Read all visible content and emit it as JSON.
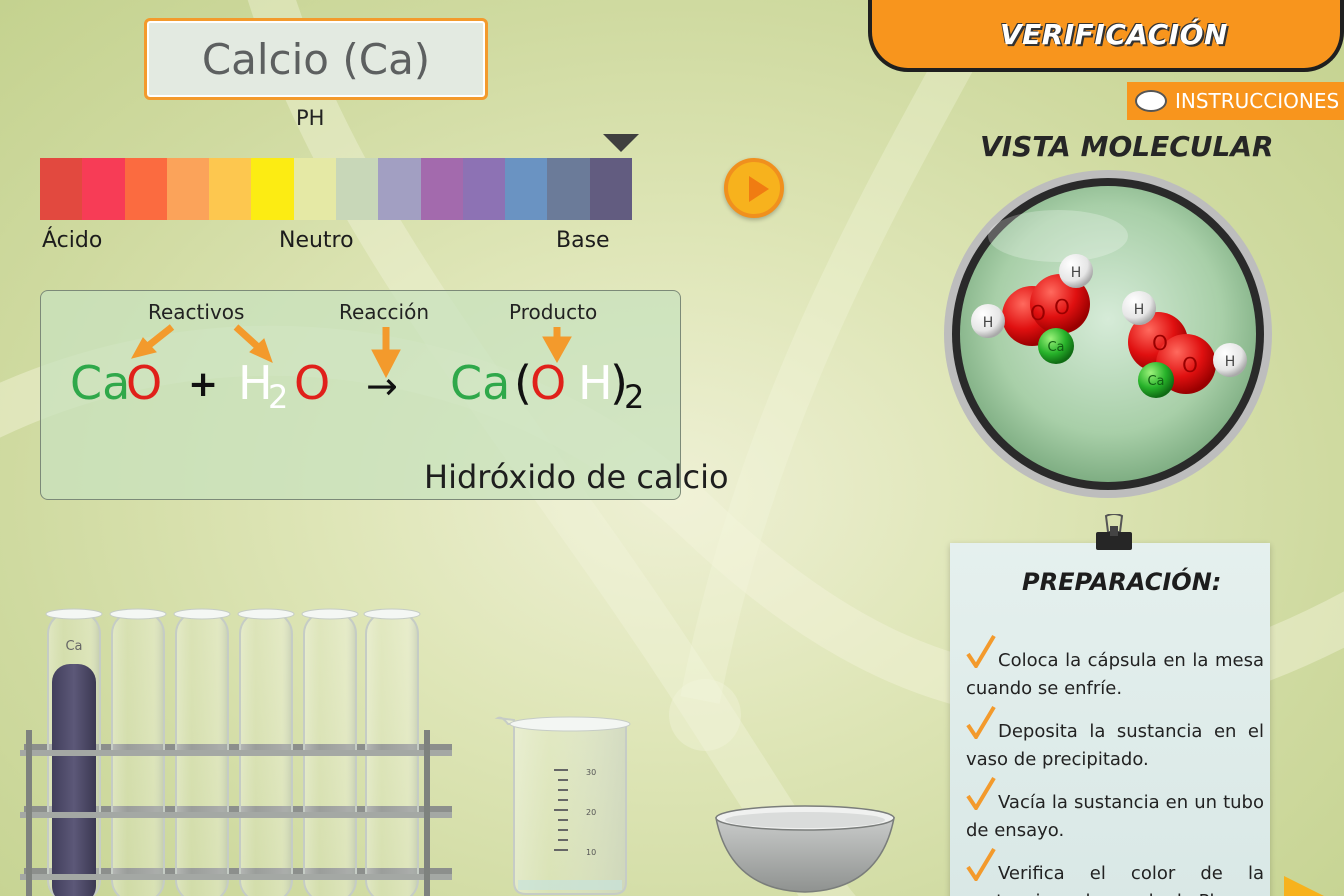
{
  "title": "Calcio (Ca)",
  "ph": {
    "label": "PH",
    "colors": [
      "#e2493f",
      "#f73c56",
      "#fb6b40",
      "#fba35a",
      "#fdc74f",
      "#fcec13",
      "#e5e9a5",
      "#c8d7b8",
      "#a29fc2",
      "#a36aad",
      "#8d72b4",
      "#6a93c2",
      "#6b7b99",
      "#625c80"
    ],
    "labels": {
      "acid": "Ácido",
      "neutral": "Neutro",
      "base": "Base"
    }
  },
  "equation": {
    "labels": {
      "reactants": "Reactivos",
      "reaction": "Reacción",
      "product": "Producto"
    },
    "parts": {
      "ca1": "Ca",
      "o1": "O",
      "plus": "+",
      "h2": "H",
      "sub2a": "2",
      "o2": "O",
      "arrow": "→",
      "ca2": "Ca",
      "lparen": "(",
      "o3": "O",
      "h3": "H",
      "rparen": ")",
      "sub2b": "2"
    },
    "product_name": "Hidróxido de calcio"
  },
  "verification_tab": "VERIFICACIÓN",
  "instructions_button": "INSTRUCCIONES",
  "molecular_view": {
    "title": "VISTA MOLECULAR",
    "atoms": {
      "h": "H",
      "ca": "Ca"
    }
  },
  "test_tube_label": "Ca",
  "beaker_marks": [
    "30",
    "20",
    "10"
  ],
  "preparation": {
    "title": "PREPARACIÓN:",
    "steps": [
      "Coloca la cápsula en la mesa cuando se enfríe.",
      "Deposita la sustancia en el vaso de precipitado.",
      "Vacía la sustancia en un tubo de ensayo.",
      "Verifica el color de la sustancia en la escala de Ph."
    ]
  },
  "colors": {
    "accent": "#f8951d",
    "green": "#2fa84a",
    "red": "#e0201a"
  }
}
